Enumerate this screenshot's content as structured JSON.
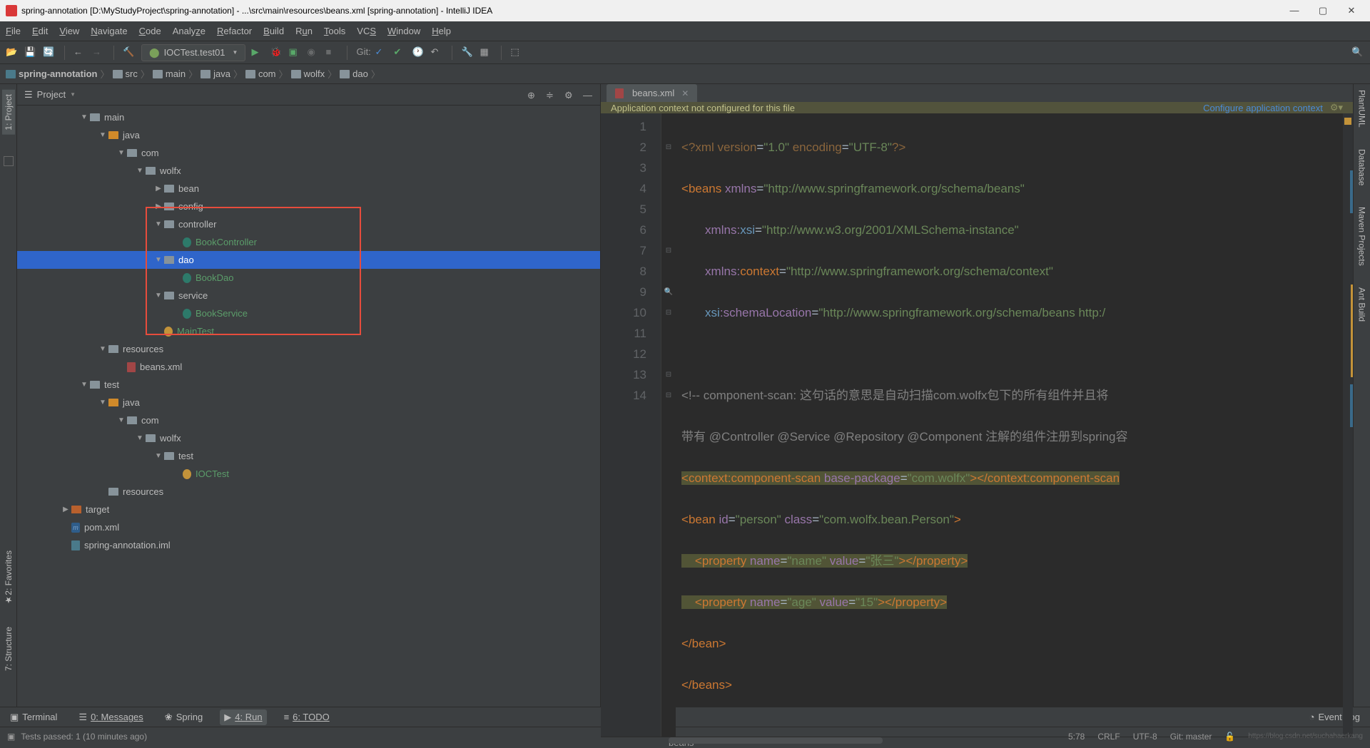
{
  "titlebar": "spring-annotation [D:\\MyStudyProject\\spring-annotation] - ...\\src\\main\\resources\\beans.xml [spring-annotation] - IntelliJ IDEA",
  "menu": [
    "File",
    "Edit",
    "View",
    "Navigate",
    "Code",
    "Analyze",
    "Refactor",
    "Build",
    "Run",
    "Tools",
    "VCS",
    "Window",
    "Help"
  ],
  "run_config": "IOCTest.test01",
  "git_label": "Git:",
  "breadcrumbs": [
    "spring-annotation",
    "src",
    "main",
    "java",
    "com",
    "wolfx",
    "dao"
  ],
  "project_label": "Project",
  "tree": [
    {
      "d": 1,
      "a": "▼",
      "ic": "folder",
      "t": "main"
    },
    {
      "d": 2,
      "a": "▼",
      "ic": "src",
      "t": "java"
    },
    {
      "d": 3,
      "a": "▼",
      "ic": "folder",
      "t": "com"
    },
    {
      "d": 4,
      "a": "▼",
      "ic": "folder",
      "t": "wolfx"
    },
    {
      "d": 5,
      "a": "▶",
      "ic": "folder",
      "t": "bean"
    },
    {
      "d": 5,
      "a": "▶",
      "ic": "folder",
      "t": "config"
    },
    {
      "d": 5,
      "a": "▼",
      "ic": "folder",
      "t": "controller"
    },
    {
      "d": 6,
      "a": "",
      "ic": "java",
      "t": "BookController",
      "g": true
    },
    {
      "d": 5,
      "a": "▼",
      "ic": "folder",
      "t": "dao",
      "sel": true
    },
    {
      "d": 6,
      "a": "",
      "ic": "java",
      "t": "BookDao",
      "g": true
    },
    {
      "d": 5,
      "a": "▼",
      "ic": "folder",
      "t": "service"
    },
    {
      "d": 6,
      "a": "",
      "ic": "java",
      "t": "BookService",
      "g": true
    },
    {
      "d": 5,
      "a": "",
      "ic": "test",
      "t": "MainTest",
      "g": true
    },
    {
      "d": 2,
      "a": "▼",
      "ic": "folder",
      "t": "resources"
    },
    {
      "d": 3,
      "a": "",
      "ic": "xml",
      "t": "beans.xml"
    },
    {
      "d": 1,
      "a": "▼",
      "ic": "folder",
      "t": "test"
    },
    {
      "d": 2,
      "a": "▼",
      "ic": "src",
      "t": "java"
    },
    {
      "d": 3,
      "a": "▼",
      "ic": "folder",
      "t": "com"
    },
    {
      "d": 4,
      "a": "▼",
      "ic": "folder",
      "t": "wolfx"
    },
    {
      "d": 5,
      "a": "▼",
      "ic": "folder",
      "t": "test"
    },
    {
      "d": 6,
      "a": "",
      "ic": "test",
      "t": "IOCTest",
      "g": true
    },
    {
      "d": 2,
      "a": "",
      "ic": "folder",
      "t": "resources"
    },
    {
      "d": 0,
      "a": "▶",
      "ic": "target",
      "t": "target"
    },
    {
      "d": 0,
      "a": "",
      "ic": "maven",
      "t": "pom.xml"
    },
    {
      "d": 0,
      "a": "",
      "ic": "file",
      "t": "spring-annotation.iml"
    }
  ],
  "editor_tab": "beans.xml",
  "banner_text": "Application context not configured for this file",
  "banner_link": "Configure application context",
  "line_numbers": [
    "1",
    "2",
    "3",
    "4",
    "5",
    "6",
    "7",
    "8",
    "9",
    "10",
    "11",
    "12",
    "13",
    "14"
  ],
  "code_crumb": "beans",
  "bottom": {
    "terminal": "Terminal",
    "messages": "0: Messages",
    "spring": "Spring",
    "run": "4: Run",
    "todo": "6: TODO",
    "eventlog": "Event Log"
  },
  "status": {
    "text": "Tests passed: 1 (10 minutes ago)",
    "pos": "5:78",
    "crlf": "CRLF",
    "enc": "UTF-8",
    "git": "Git: master"
  },
  "left_tabs": [
    "1: Project",
    "2: Favorites",
    "7: Structure"
  ],
  "right_tabs": [
    "PlantUML",
    "Database",
    "Maven Projects",
    "Ant Build"
  ],
  "watermark": "https://blog.csdn.net/suchahaerkang",
  "code": {
    "l1_a": "<?",
    "l1_b": "xml version",
    "l1_c": "=",
    "l1_d": "\"1.0\"",
    "l1_e": " encoding",
    "l1_f": "=",
    "l1_g": "\"UTF-8\"",
    "l1_h": "?>",
    "l2_a": "<",
    "l2_b": "beans ",
    "l2_c": "xmlns",
    "l2_d": "=",
    "l2_e": "\"http://www.springframework.org/schema/beans\"",
    "l3_a": "       xmlns:",
    "l3_b": "xsi",
    "l3_c": "=",
    "l3_d": "\"http://www.w3.org/2001/XMLSchema-instance\"",
    "l4_a": "       xmlns:",
    "l4_b": "context",
    "l4_c": "=",
    "l4_d": "\"http://www.springframework.org/schema/context\"",
    "l5_a": "       xsi",
    "l5_b": ":schemaLocation",
    "l5_c": "=",
    "l5_d": "\"http://www.springframework.org/schema/beans http:/",
    "l7": "<!-- component-scan: 这句话的意思是自动扫描com.wolfx包下的所有组件并且将",
    "l8": "带有 @Controller @Service @Repository @Component 注解的组件注册到spring容",
    "l9_a": "<",
    "l9_b": "context",
    "l9_c": ":component-scan ",
    "l9_d": "base-package",
    "l9_e": "=",
    "l9_f": "\"com.wolfx\"",
    "l9_g": "></",
    "l9_h": "context",
    "l9_i": ":component-scan",
    "l10_a": "<",
    "l10_b": "bean ",
    "l10_c": "id",
    "l10_d": "=",
    "l10_e": "\"person\"",
    "l10_f": " class",
    "l10_g": "=",
    "l10_h": "\"com.wolfx.bean.Person\"",
    "l10_i": ">",
    "l11_a": "    <",
    "l11_b": "property ",
    "l11_c": "name",
    "l11_d": "=",
    "l11_e": "\"name\"",
    "l11_f": " value",
    "l11_g": "=",
    "l11_h": "\"张三\"",
    "l11_i": "></",
    "l11_j": "property",
    "l11_k": ">",
    "l12_a": "    <",
    "l12_b": "property ",
    "l12_c": "name",
    "l12_d": "=",
    "l12_e": "\"age\"",
    "l12_f": " value",
    "l12_g": "=",
    "l12_h": "\"15\"",
    "l12_i": "></",
    "l12_j": "property",
    "l12_k": ">",
    "l13_a": "</",
    "l13_b": "bean",
    "l13_c": ">",
    "l14_a": "</",
    "l14_b": "beans",
    "l14_c": ">"
  }
}
